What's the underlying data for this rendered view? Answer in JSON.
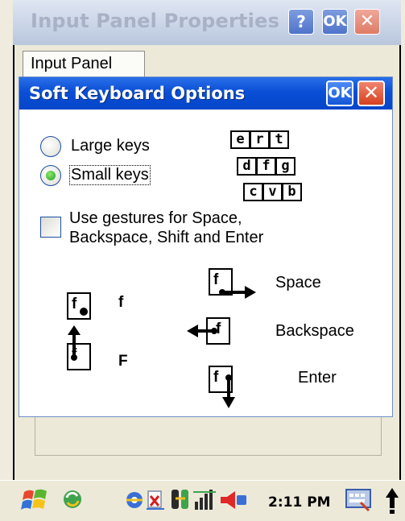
{
  "background_window": {
    "title": "Input Panel Properties",
    "help_label": "?",
    "ok_label": "OK",
    "close_label": "✕",
    "tab_label": "Input Panel"
  },
  "dialog": {
    "title": "Soft Keyboard Options",
    "ok_label": "OK",
    "close_label": "✕",
    "radio_large": {
      "label": "Large keys",
      "selected": false
    },
    "radio_small": {
      "label": "Small keys",
      "selected": true
    },
    "keys_preview": [
      [
        "e",
        "r",
        "t"
      ],
      [
        "d",
        "f",
        "g"
      ],
      [
        "c",
        "v",
        "b"
      ]
    ],
    "gestures_checkbox": {
      "checked": false,
      "line1": "Use gestures for Space,",
      "line2": "Backspace, Shift and Enter"
    },
    "gestures": {
      "key_letter": "f",
      "tap_result": "f",
      "shift_result": "F",
      "space_label": "Space",
      "backspace_label": "Backspace",
      "enter_label": "Enter"
    }
  },
  "taskbar": {
    "time": "2:11 PM",
    "icons": [
      "windows-start-icon",
      "sync-icon",
      "internet-explorer-icon",
      "connection-icon",
      "network-icon",
      "signal-icon",
      "speaker-icon",
      "input-panel-icon",
      "arrow-up-icon"
    ]
  }
}
